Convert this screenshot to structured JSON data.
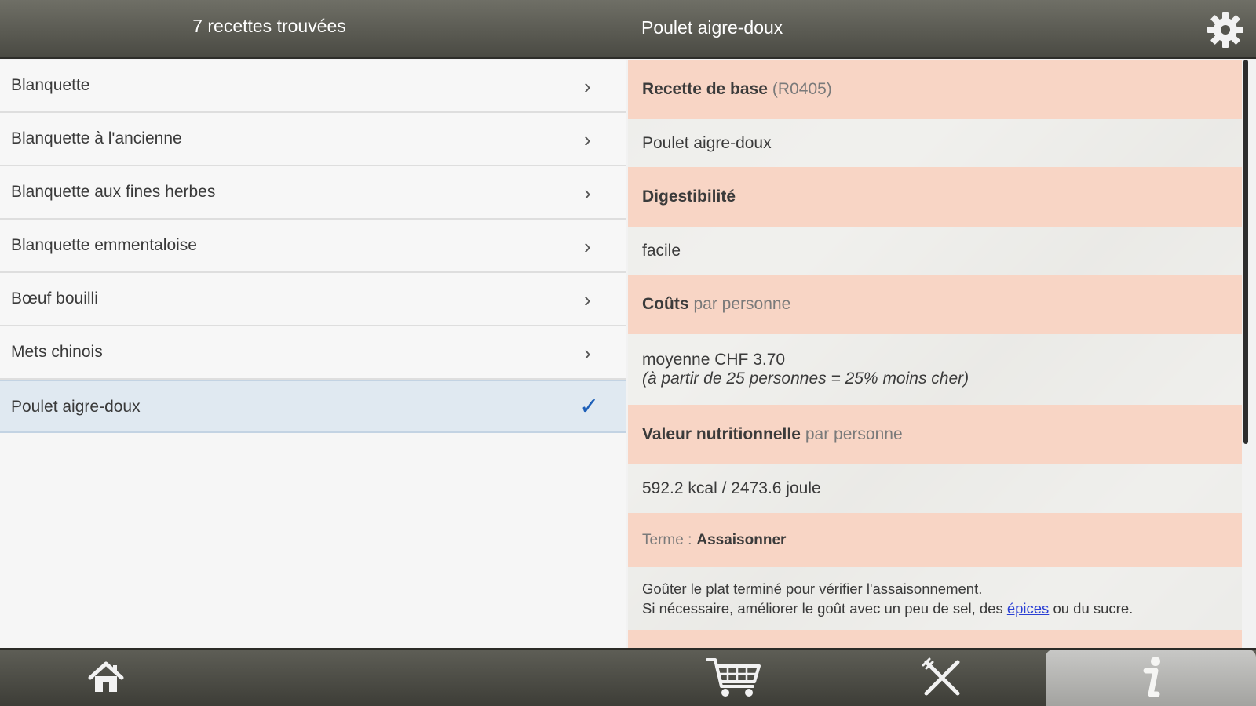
{
  "header": {
    "results_title": "7 recettes trouvées",
    "detail_title": "Poulet aigre-doux",
    "settings_icon": "gear-icon"
  },
  "recipes": [
    {
      "label": "Blanquette"
    },
    {
      "label": "Blanquette à l'ancienne"
    },
    {
      "label": "Blanquette aux fines herbes"
    },
    {
      "label": "Blanquette emmentaloise"
    },
    {
      "label": "Bœuf bouilli"
    },
    {
      "label": "Mets chinois"
    },
    {
      "label": "Poulet aigre-doux",
      "selected": true
    }
  ],
  "detail": {
    "base_recipe_label": "Recette de base",
    "base_recipe_code": "(R0405)",
    "base_recipe_value": "Poulet aigre-doux",
    "digestibility_label": "Digestibilité",
    "digestibility_value": "facile",
    "cost_label": "Coûts",
    "cost_suffix": "par personne",
    "cost_value": "moyenne CHF 3.70",
    "cost_note": "(à partir de 25 personnes = 25% moins cher)",
    "nutrition_label": "Valeur nutritionnelle",
    "nutrition_suffix": "par personne",
    "nutrition_value": "592.2 kcal / 2473.6 joule",
    "term_prefix": "Terme :",
    "term_value": "Assaisonner",
    "term_line1": "Goûter le plat terminé pour vérifier l'assaisonnement.",
    "term_line2_before": "Si nécessaire, améliorer le goût avec un peu de sel, des ",
    "term_link": "épices",
    "term_line2_after": " ou du sucre."
  },
  "bottom_nav": {
    "tabs": [
      {
        "icon": "home-icon"
      },
      {
        "icon": "cart-icon"
      },
      {
        "icon": "utensils-icon"
      },
      {
        "icon": "info-icon",
        "active": true
      }
    ]
  },
  "colors": {
    "section_header": "#f8d5c5",
    "selected_row": "#e0e9f1",
    "check": "#1d5fb8",
    "link": "#2a3fd4"
  }
}
